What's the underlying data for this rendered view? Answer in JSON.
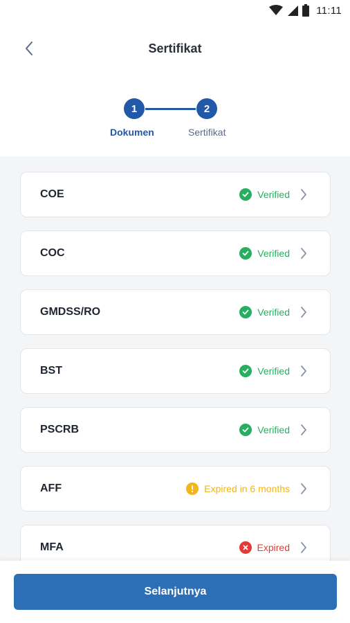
{
  "status_bar": {
    "time": "11:11"
  },
  "header": {
    "title": "Sertifikat"
  },
  "stepper": {
    "steps": [
      {
        "number": "1",
        "label": "Dokumen"
      },
      {
        "number": "2",
        "label": "Sertifikat"
      }
    ]
  },
  "certificates": [
    {
      "name": "COE",
      "status": "Verified",
      "status_type": "verified"
    },
    {
      "name": "COC",
      "status": "Verified",
      "status_type": "verified"
    },
    {
      "name": "GMDSS/RO",
      "status": "Verified",
      "status_type": "verified"
    },
    {
      "name": "BST",
      "status": "Verified",
      "status_type": "verified"
    },
    {
      "name": "PSCRB",
      "status": "Verified",
      "status_type": "verified"
    },
    {
      "name": "AFF",
      "status": "Expired in 6 months",
      "status_type": "warning"
    },
    {
      "name": "MFA",
      "status": "Expired",
      "status_type": "expired"
    }
  ],
  "colors": {
    "primary": "#2158a8",
    "button": "#2c6fb7",
    "verified": "#27ae60",
    "warning": "#f2b619",
    "expired": "#e53935"
  },
  "footer": {
    "next_label": "Selanjutnya"
  }
}
